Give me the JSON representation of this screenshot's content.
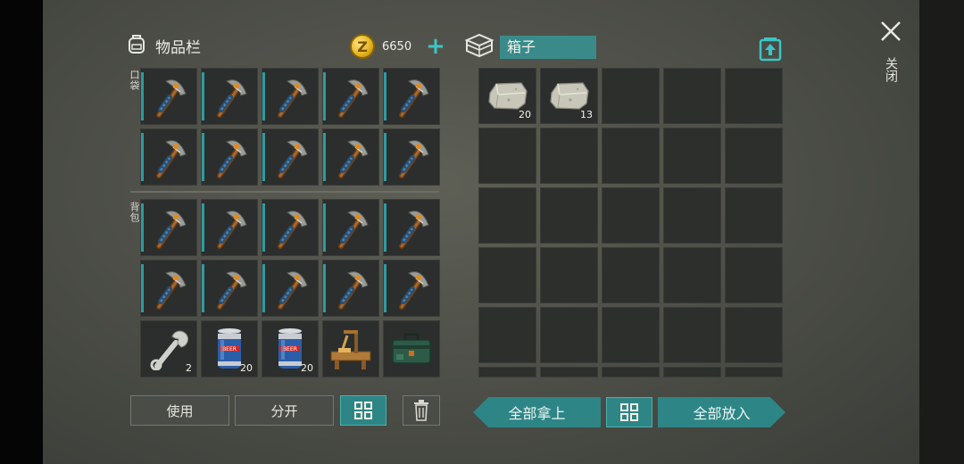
{
  "inventory": {
    "title": "物品栏",
    "coins": "6650",
    "pocket_label": "口袋",
    "backpack_label": "背包",
    "pocket_slots": [
      {
        "icon": "pickaxe-icon",
        "count": ""
      },
      {
        "icon": "pickaxe-icon",
        "count": ""
      },
      {
        "icon": "pickaxe-icon",
        "count": ""
      },
      {
        "icon": "pickaxe-icon",
        "count": ""
      },
      {
        "icon": "pickaxe-icon",
        "count": ""
      },
      {
        "icon": "pickaxe-icon",
        "count": ""
      },
      {
        "icon": "pickaxe-icon",
        "count": ""
      },
      {
        "icon": "pickaxe-icon",
        "count": ""
      },
      {
        "icon": "pickaxe-icon",
        "count": ""
      },
      {
        "icon": "pickaxe-icon",
        "count": ""
      }
    ],
    "backpack_slots": [
      {
        "icon": "pickaxe-icon",
        "count": ""
      },
      {
        "icon": "pickaxe-icon",
        "count": ""
      },
      {
        "icon": "pickaxe-icon",
        "count": ""
      },
      {
        "icon": "pickaxe-icon",
        "count": ""
      },
      {
        "icon": "pickaxe-icon",
        "count": ""
      },
      {
        "icon": "pickaxe-icon",
        "count": ""
      },
      {
        "icon": "pickaxe-icon",
        "count": ""
      },
      {
        "icon": "pickaxe-icon",
        "count": ""
      },
      {
        "icon": "pickaxe-icon",
        "count": ""
      },
      {
        "icon": "pickaxe-icon",
        "count": ""
      },
      {
        "icon": "wrench-icon",
        "count": "2"
      },
      {
        "icon": "beer-can-icon",
        "count": "20"
      },
      {
        "icon": "beer-can-icon",
        "count": "20"
      },
      {
        "icon": "workbench-icon",
        "count": ""
      },
      {
        "icon": "toolbox-icon",
        "count": ""
      }
    ],
    "use_label": "使用",
    "split_label": "分开"
  },
  "container": {
    "title": "箱子",
    "slots": [
      {
        "icon": "stone-icon",
        "count": "20"
      },
      {
        "icon": "stone-icon",
        "count": "13"
      }
    ],
    "take_all_label": "全部拿上",
    "put_all_label": "全部放入"
  },
  "close_label": "关闭",
  "colors": {
    "accent": "#2e8585",
    "teal_bar": "#2f9aa0",
    "coin": "#e2b21c"
  }
}
